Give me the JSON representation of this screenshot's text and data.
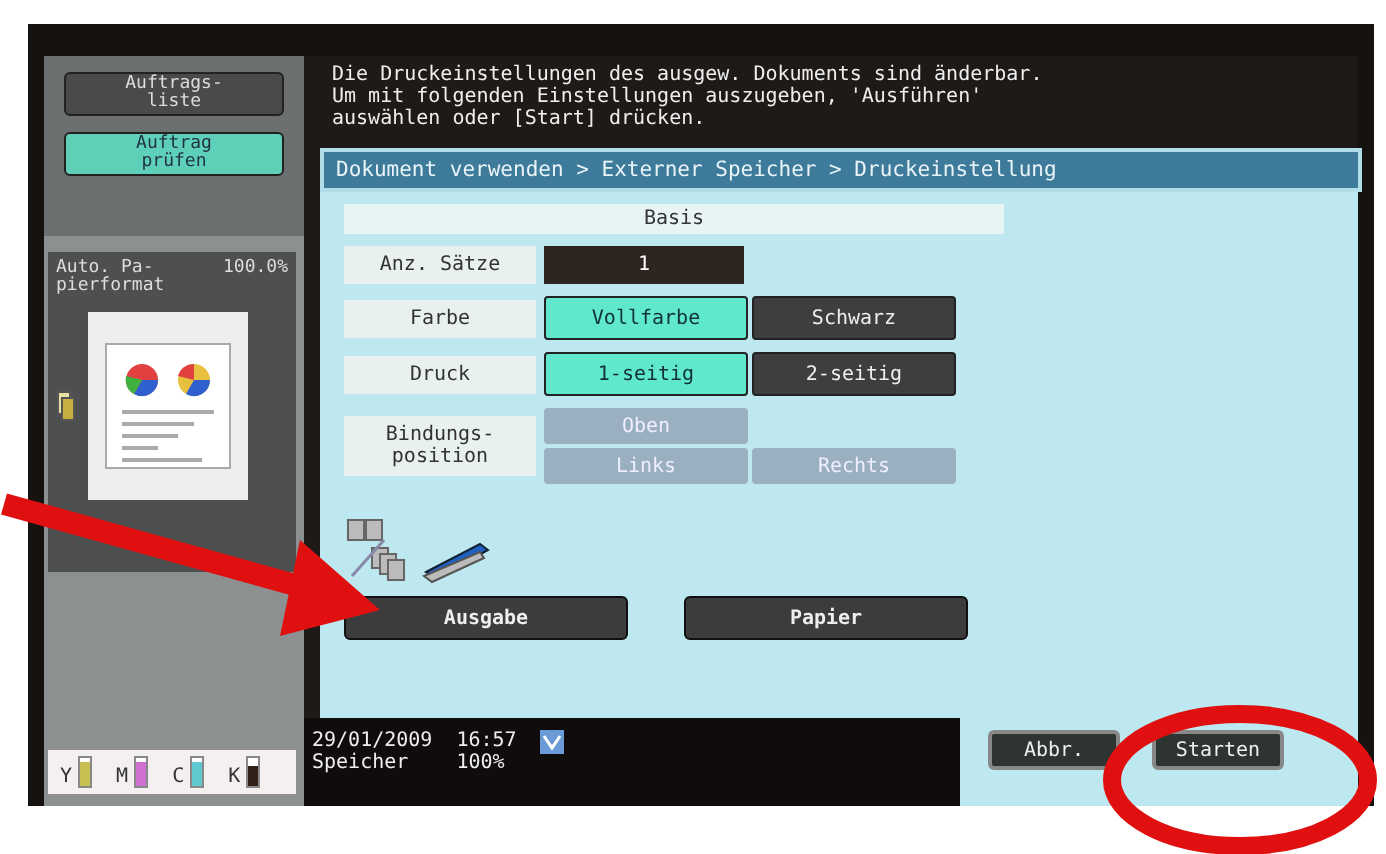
{
  "sidebar": {
    "buttons": [
      {
        "label": "Auftrags-liste",
        "selected": false
      },
      {
        "label": "Auftrag prüfen",
        "selected": true
      }
    ],
    "preview": {
      "label": "Auto. Pa-pierformat",
      "zoom": "100.0%"
    },
    "toner": [
      {
        "label": "Y",
        "level": 0.85,
        "color": "#c8c050"
      },
      {
        "label": "M",
        "level": 0.85,
        "color": "#d070d0"
      },
      {
        "label": "C",
        "level": 0.85,
        "color": "#60c8d0"
      },
      {
        "label": "K",
        "level": 0.7,
        "color": "#302018"
      }
    ]
  },
  "message": "Die Druckeinstellungen des ausgew. Dokuments sind änderbar.\nUm mit folgenden Einstellungen auszugeben, 'Ausführen'\nauswählen oder [Start] drücken.",
  "breadcrumb": "Dokument verwenden > Externer Speicher > Druckeinstellung",
  "panel": {
    "title": "Basis",
    "rows": [
      {
        "kind": "value",
        "label": "Anz. Sätze",
        "value": "1"
      },
      {
        "kind": "choice",
        "label": "Farbe",
        "options": [
          {
            "label": "Vollfarbe",
            "selected": true,
            "disabled": false
          },
          {
            "label": "Schwarz",
            "selected": false,
            "disabled": false
          }
        ]
      },
      {
        "kind": "choice",
        "label": "Druck",
        "options": [
          {
            "label": "1-seitig",
            "selected": true,
            "disabled": false
          },
          {
            "label": "2-seitig",
            "selected": false,
            "disabled": false
          }
        ]
      },
      {
        "kind": "binding",
        "label": "Bindungs-position",
        "options": [
          {
            "label": "Oben",
            "disabled": true
          },
          {
            "label": "Links",
            "disabled": true
          },
          {
            "label": "Rechts",
            "disabled": true
          }
        ]
      }
    ],
    "buttons": [
      "Ausgabe",
      "Papier"
    ]
  },
  "status": {
    "date": "29/01/2009",
    "time": "16:57",
    "memory_label": "Speicher",
    "memory": "100%"
  },
  "actions": [
    "Abbr.",
    "Starten"
  ]
}
